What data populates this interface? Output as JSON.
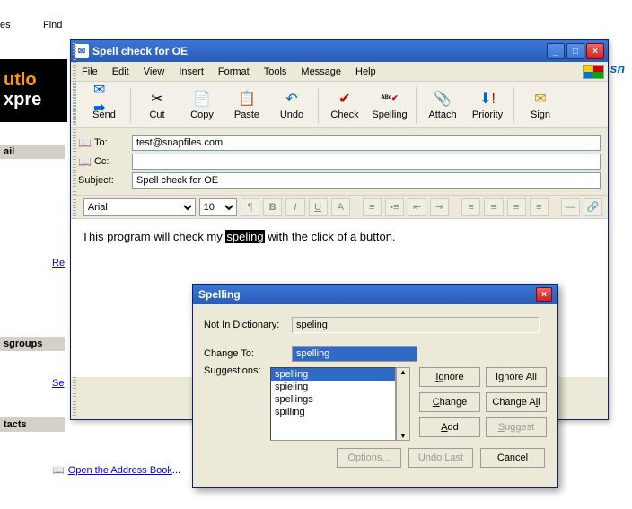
{
  "background": {
    "menu_items": [
      "es",
      "Find"
    ],
    "logo_text_top": "utlo",
    "logo_text_bottom": "xpre",
    "sidebar_ail": "ail",
    "sidebar_sgroups": "sgroups",
    "sidebar_tacts": "tacts",
    "link_re": "Re",
    "link_se": "Se",
    "link_addressbook": "Open the Address Book",
    "msn_hint": "sn"
  },
  "window": {
    "title": "Spell check for OE",
    "menu": {
      "file": "File",
      "edit": "Edit",
      "view": "View",
      "insert": "Insert",
      "format": "Format",
      "tools": "Tools",
      "message": "Message",
      "help": "Help"
    },
    "toolbar": {
      "send": "Send",
      "cut": "Cut",
      "copy": "Copy",
      "paste": "Paste",
      "undo": "Undo",
      "check": "Check",
      "spelling": "Spelling",
      "attach": "Attach",
      "priority": "Priority",
      "sign": "Sign"
    },
    "fields": {
      "to_label": "To:",
      "to_value": "test@snapfiles.com",
      "cc_label": "Cc:",
      "cc_value": "",
      "subject_label": "Subject:",
      "subject_value": "Spell check for OE"
    },
    "format": {
      "font": "Arial",
      "size": "10"
    },
    "body": {
      "pre": "This program will check my ",
      "misspelled": "speling",
      "post": " with the click of a button."
    }
  },
  "spelling_dialog": {
    "title": "Spelling",
    "not_in_dict_label": "Not In Dictionary:",
    "not_in_dict_value": "speling",
    "change_to_label": "Change To:",
    "change_to_value": "spelling",
    "suggestions_label": "Suggestions:",
    "suggestions": [
      "spelling",
      "spieling",
      "spellings",
      "spilling"
    ],
    "selected_suggestion_index": 0,
    "buttons": {
      "ignore": "Ignore",
      "ignore_all": "Ignore All",
      "change": "Change",
      "change_all": "Change All",
      "add": "Add",
      "suggest": "Suggest",
      "options": "Options...",
      "undo_last": "Undo Last",
      "cancel": "Cancel"
    }
  }
}
